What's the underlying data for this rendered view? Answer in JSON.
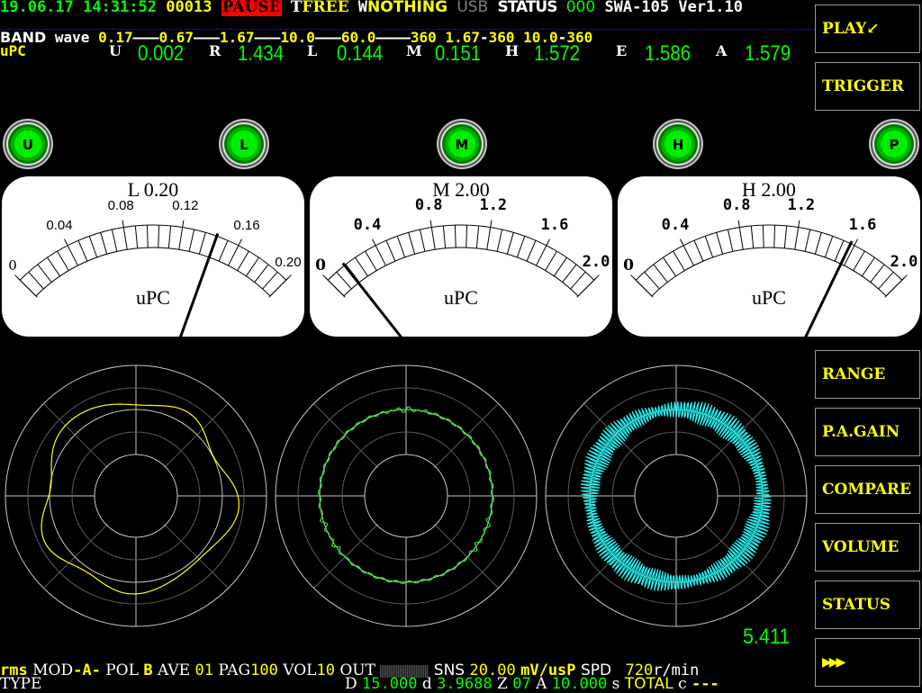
{
  "status_bar": {
    "date": "19.06.17",
    "time": "14:31:52",
    "counter": "00013",
    "state": "PAUSE",
    "t_label": "T",
    "t_value": "FREE",
    "w_label": "W",
    "w_value": "NOTHING",
    "usb": "USB",
    "status_label": "STATUS",
    "status_value": "000",
    "model": "SWA-105",
    "version": "Ver1.10"
  },
  "band_row": {
    "label": "BAND",
    "mode": "wave",
    "ranges": [
      "0.17",
      "0.67",
      "1.67",
      "10.0",
      "60.0",
      "360",
      "1.67",
      "360",
      "10.0",
      "360"
    ]
  },
  "readings": {
    "unit_label": "uPC",
    "items": [
      {
        "key": "U",
        "value": "0.002"
      },
      {
        "key": "R",
        "value": "1.434"
      },
      {
        "key": "L",
        "value": "0.144"
      },
      {
        "key": "M",
        "value": "0.151"
      },
      {
        "key": "H",
        "value": "1.572"
      },
      {
        "key": "E",
        "value": "1.586"
      },
      {
        "key": "A",
        "value": "1.579"
      }
    ]
  },
  "indicators": [
    {
      "label": "U",
      "state": "on"
    },
    {
      "label": "L",
      "state": "on"
    },
    {
      "label": "M",
      "state": "on"
    },
    {
      "label": "H",
      "state": "on"
    },
    {
      "label": "P",
      "state": "on"
    }
  ],
  "meters": [
    {
      "title": "L 0.20",
      "unit": "uPC",
      "min": 0,
      "max": 0.2,
      "value": 0.144,
      "tick_labels": [
        "0",
        "0.04",
        "0.08",
        "0.12",
        "0.16",
        "0.20"
      ]
    },
    {
      "title": "M 2.00",
      "unit": "uPC",
      "min": 0,
      "max": 2.0,
      "value": 0.151,
      "tick_labels": [
        "0",
        "0.4",
        "0.8",
        "1.2",
        "1.6",
        "2.0"
      ]
    },
    {
      "title": "H 2.00",
      "unit": "uPC",
      "min": 0,
      "max": 2.0,
      "value": 1.572,
      "tick_labels": [
        "0",
        "0.4",
        "0.8",
        "1.2",
        "1.6",
        "2.0"
      ]
    }
  ],
  "polar_plots": [
    {
      "name": "L",
      "color": "#ffff00",
      "style": "smooth-lobed"
    },
    {
      "name": "M",
      "color": "#22ee22",
      "style": "near-circle"
    },
    {
      "name": "H",
      "color": "#22eeee",
      "style": "high-frequency"
    }
  ],
  "overall_value": "5.411",
  "side_buttons_top": [
    {
      "label": "PLAY↙"
    },
    {
      "label": "TRIGGER"
    }
  ],
  "side_buttons_bottom": [
    {
      "label": "RANGE"
    },
    {
      "label": "P.A.GAIN"
    },
    {
      "label": "COMPARE"
    },
    {
      "label": "VOLUME"
    },
    {
      "label": "STATUS"
    },
    {
      "label": "▶▶▶"
    }
  ],
  "footer": {
    "rms": "rms",
    "mod_label": "MOD",
    "mod_value": "-A-",
    "pol_label": "POL",
    "pol_value": "B",
    "ave_label": "AVE",
    "ave_value": "01",
    "pag_label": "PAG",
    "pag_value": "100",
    "vol_label": "VOL",
    "vol_value": "10",
    "out_label": "OUT",
    "sns_label": "SNS",
    "sns_value": "20.00",
    "sns_unit": "mV/usP",
    "spd_label": "SPD",
    "spd_value": "720",
    "spd_unit": "r/min",
    "type_label": "TYPE",
    "d_label": "D",
    "d_value": "15.000",
    "d2_label": "d",
    "d2_value": "3.9688",
    "z_label": "Z",
    "z_value": "07",
    "a_label": "A",
    "a_value": "10.000",
    "s_label": "s",
    "total_label": "TOTAL",
    "c_label": "c",
    "c_value": "---"
  },
  "colors": {
    "green": "#00ff00",
    "yellow": "#ffff00",
    "pause_bg": "#ff0000",
    "divider": "#0000ff"
  }
}
